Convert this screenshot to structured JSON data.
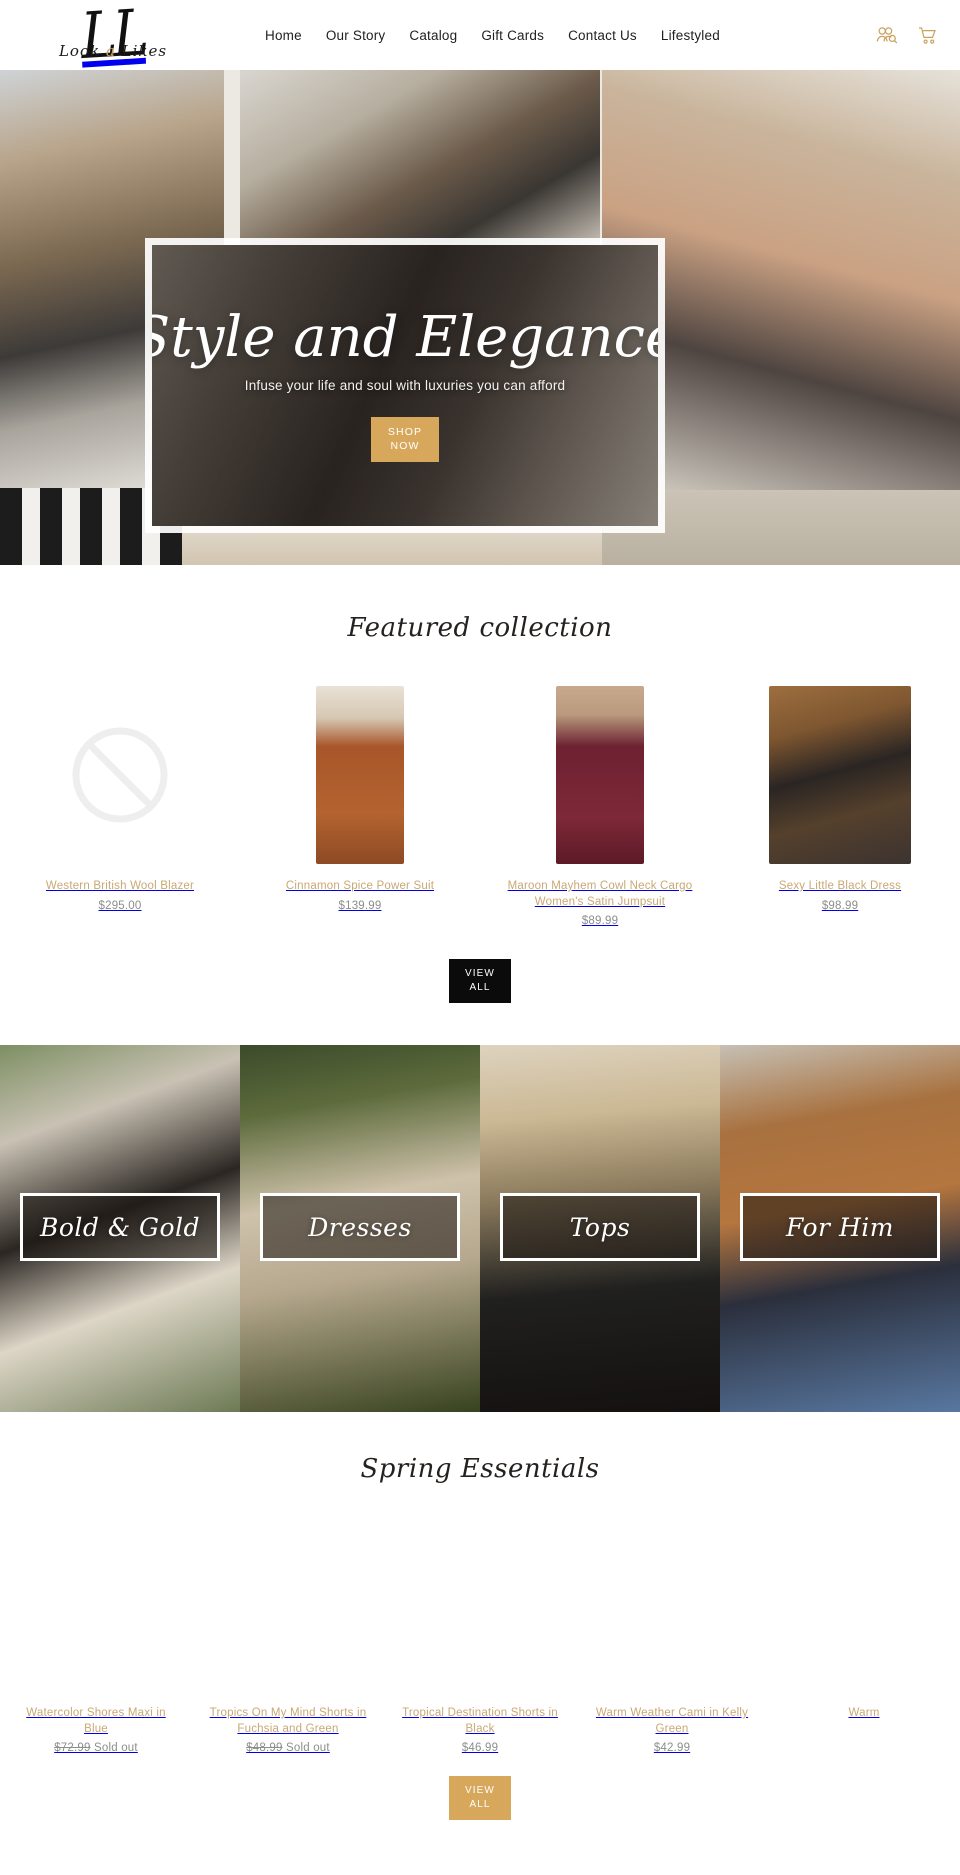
{
  "brand": {
    "logo_text": "LL",
    "logo_wordmark": "Look a Likes",
    "logo_word_1": "Look",
    "logo_amp": "a",
    "logo_word_2": "Likes",
    "accent_gold": "#c9a15c",
    "button_gold": "#d7a85c",
    "title_gold": "#c9a873",
    "price_gray": "#8d8d8d"
  },
  "header": {
    "nav": [
      {
        "label": "Home"
      },
      {
        "label": "Our Story"
      },
      {
        "label": "Catalog"
      },
      {
        "label": "Gift Cards"
      },
      {
        "label": "Contact Us"
      },
      {
        "label": "Lifestyled"
      }
    ],
    "icons": [
      {
        "name": "account-search-icon",
        "label": "Account"
      },
      {
        "name": "cart-icon",
        "label": "Cart"
      }
    ]
  },
  "hero": {
    "title": "Style and Elegance",
    "subtitle": "Infuse your life and soul with luxuries you can afford",
    "cta_line1": "SHOP",
    "cta_line2": "NOW"
  },
  "featured": {
    "title": "Featured collection",
    "view_all_line1": "VIEW",
    "view_all_line2": "ALL",
    "products": [
      {
        "title": "Western British Wool Blazer",
        "price": "$295.00",
        "image": "no-image-placeholder",
        "sold_out": false
      },
      {
        "title": "Cinnamon Spice Power Suit",
        "price": "$139.99",
        "image": "rust-jumpsuit-photo",
        "sold_out": false
      },
      {
        "title": "Maroon Mayhem Cowl Neck Cargo Women's Satin Jumpsuit",
        "price": "$89.99",
        "image": "maroon-jumpsuit-photo",
        "sold_out": false
      },
      {
        "title": "Sexy Little Black Dress",
        "price": "$98.99",
        "image": "black-dress-photo",
        "sold_out": false
      }
    ]
  },
  "collections": [
    {
      "label": "Bold & Gold",
      "image": "bold-and-gold-photo"
    },
    {
      "label": "Dresses",
      "image": "dresses-photo"
    },
    {
      "label": "Tops",
      "image": "tops-photo"
    },
    {
      "label": "For Him",
      "image": "for-him-photo"
    }
  ],
  "spring": {
    "title": "Spring Essentials",
    "products": [
      {
        "title": "Watercolor Shores Maxi in Blue",
        "price_was": "$72.99",
        "status": "Sold out",
        "sold_out": true
      },
      {
        "title": "Tropics On My Mind Shorts in Fuchsia and Green",
        "price_was": "$48.99",
        "status": "Sold out",
        "sold_out": true
      },
      {
        "title": "Tropical Destination Shorts in Black",
        "price": "$46.99",
        "sold_out": false
      },
      {
        "title": "Warm Weather Cami in Kelly Green",
        "price": "$42.99",
        "sold_out": false
      },
      {
        "title": "Warm",
        "price": "",
        "sold_out": false
      }
    ]
  }
}
